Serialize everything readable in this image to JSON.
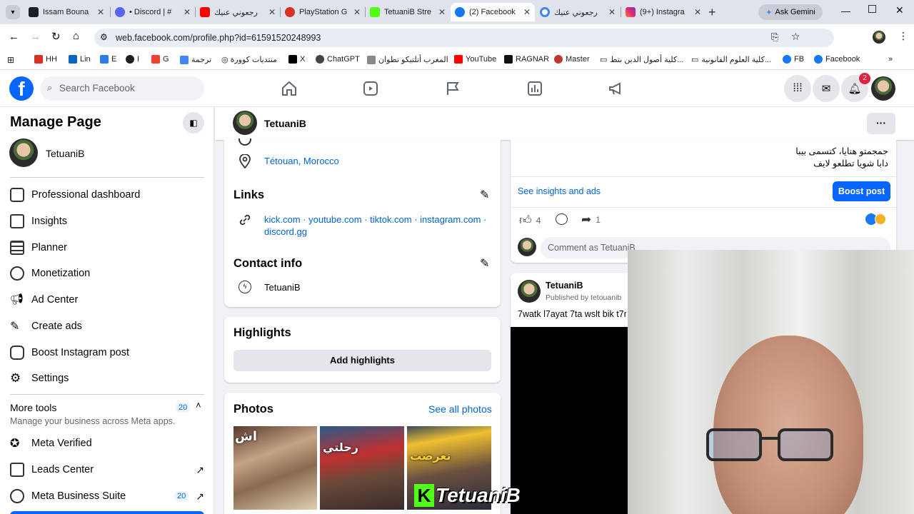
{
  "browser": {
    "tabs": [
      {
        "title": "Issam Bouna",
        "color": "#1f1f1f"
      },
      {
        "title": "• Discord | #",
        "color": "#5865f2"
      },
      {
        "title": "رجعوني عنيك",
        "color": "#ff0000"
      },
      {
        "title": "PlayStation G",
        "color": "#d93025"
      },
      {
        "title": "TetuaniB Stre",
        "color": "#53fc18"
      },
      {
        "title": "(2) Facebook",
        "color": "#1877f2"
      },
      {
        "title": "رجعوني عنيك",
        "color": "#4285f4"
      },
      {
        "title": "(9+) Instagra",
        "color": "#e1306c"
      }
    ],
    "gemini_label": "Ask Gemini",
    "url": "web.facebook.com/profile.php?id=61591520248993",
    "bookmarks": [
      "HH",
      "Lin",
      "E",
      "I",
      "G",
      "ترجمة",
      "منتديات كوورة",
      "X",
      "ChatGPT",
      "المغرب أتلتيكو تطوان",
      "YouTube",
      "RAGNAR",
      "Master",
      "كلية أصول الدين بتط...",
      "كلية العلوم القانونية...",
      "FB",
      "Facebook"
    ]
  },
  "header": {
    "search_placeholder": "Search Facebook",
    "notification_count": "2"
  },
  "left": {
    "title": "Manage Page",
    "page_name": "TetuaniB",
    "menu": [
      {
        "label": "Professional dashboard",
        "icon": "dashboard-icon"
      },
      {
        "label": "Insights",
        "icon": "insights-icon"
      },
      {
        "label": "Planner",
        "icon": "planner-icon"
      },
      {
        "label": "Monetization",
        "icon": "monetization-icon"
      },
      {
        "label": "Ad Center",
        "icon": "megaphone-icon"
      },
      {
        "label": "Create ads",
        "icon": "pencil-icon"
      },
      {
        "label": "Boost Instagram post",
        "icon": "instagram-icon"
      },
      {
        "label": "Settings",
        "icon": "gear-icon"
      }
    ],
    "more_tools_title": "More tools",
    "more_tools_count": "20",
    "more_tools_sub": "Manage your business across Meta apps.",
    "tools": [
      {
        "label": "Meta Verified",
        "icon": "verified-icon"
      },
      {
        "label": "Leads Center",
        "icon": "leads-icon"
      },
      {
        "label": "Meta Business Suite",
        "icon": "business-suite-icon",
        "count": "20"
      }
    ]
  },
  "profile_bar": {
    "name": "TetuaniB"
  },
  "intro": {
    "location": "Tétouan, Morocco",
    "links_title": "Links",
    "links": "kick.com · youtube.com · tiktok.com · instagram.com · discord.gg",
    "contact_title": "Contact info",
    "contact": "TetuaniB"
  },
  "highlights": {
    "title": "Highlights",
    "button": "Add highlights"
  },
  "photos": {
    "title": "Photos",
    "see_all": "See all photos"
  },
  "post1": {
    "lines": [
      "جمجمتو هنايا، كتسمى بيبا",
      "دابا شويا تطلعو لايف"
    ],
    "insights": "See insights and ads",
    "boost": "Boost post",
    "likes": "4",
    "shares": "1",
    "comment_placeholder": "Comment as TetuaniB"
  },
  "post2": {
    "author": "TetuaniB",
    "published": "Published by tetouanib",
    "text": "7watk l7ayat 7ta wslt bik t7r"
  },
  "watermark": "TetuaniB"
}
